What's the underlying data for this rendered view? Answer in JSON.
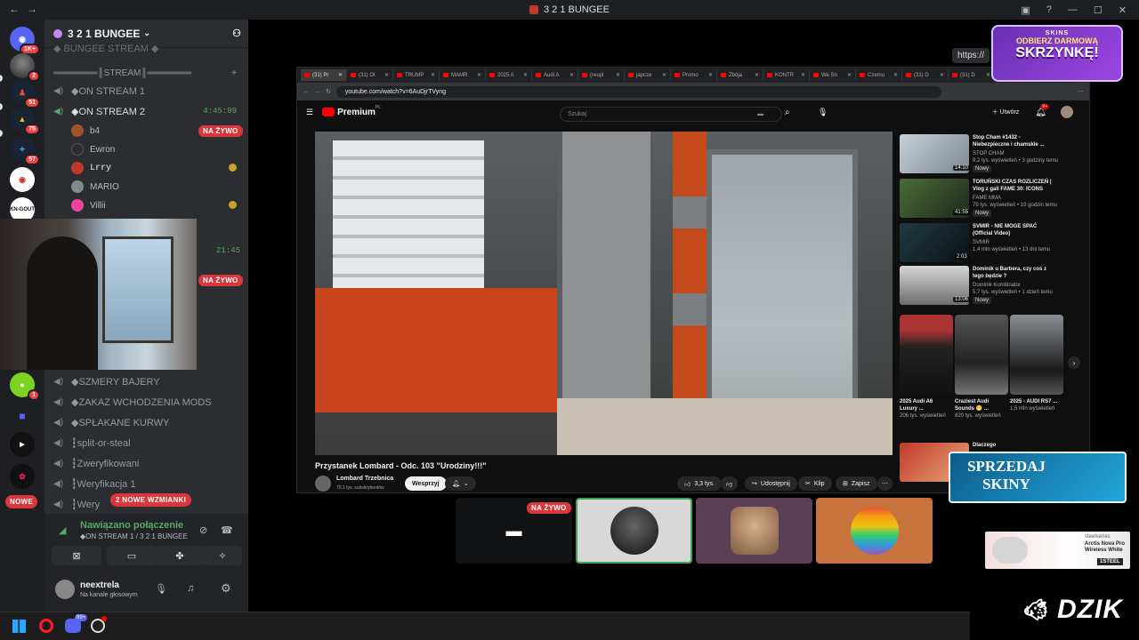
{
  "window": {
    "title": "3 2 1 BUNGEE"
  },
  "servers": [
    {
      "badge": "1K+"
    },
    {
      "badge": "2"
    },
    {
      "badge": "51"
    },
    {
      "badge": "75"
    },
    {
      "badge": "57"
    },
    {
      "badge": ""
    },
    {
      "label": "KN-GOUT",
      "badge": ""
    },
    {
      "badge": "1"
    }
  ],
  "server_header": {
    "name": "3 2 1 BUNGEE"
  },
  "channels": {
    "top_partial": "◆ BUNGEE STREAM ◆",
    "category": "═══════║STREAM║═══════",
    "on_stream_1": "◆ON STREAM 1",
    "on_stream_2": "◆ON STREAM 2",
    "on_stream_2_time": "4:45:09",
    "live_label": "NA ŻYWO",
    "hidden_time": "21:45",
    "szmery": "◆SZMERY BAJERY",
    "zakaz": "◆ZAKAZ WCHODZENIA MODS",
    "splakane": "◆SPŁAKANE KURWY",
    "split": "┇split-or-steal",
    "zweryfikowani": "┇Zweryfikowani",
    "weryfikacja": "┇Weryfikacja 1",
    "wery_partial": "┇Wery",
    "new_badge": "NOWE",
    "mentions": "2 NOWE WZMIANKI"
  },
  "users": [
    {
      "name": "b4"
    },
    {
      "name": "Ewron"
    },
    {
      "name": "Lrry"
    },
    {
      "name": "MARIO"
    },
    {
      "name": "Villii"
    }
  ],
  "voice": {
    "status": "Nawiązano połączenie",
    "channel": "◆ON STREAM 1 / 3 2 1 BUNGEE"
  },
  "account": {
    "name": "neextrela",
    "status": "Na kanale głosowym"
  },
  "browser": {
    "tabs": [
      "(31) Pr",
      "(31) Ol",
      "TRUMP",
      "MAMR",
      "2025 A",
      "Audi A",
      "(reupl",
      "japcze",
      "Promo",
      "Zbója",
      "KONTR",
      "We Sn",
      "Czemu",
      "(31) D",
      "(31) D"
    ],
    "url": "youtube.com/watch?v=6AuDjrTVyng"
  },
  "youtube": {
    "logo": "Premium",
    "logo_sup": "PL",
    "search_placeholder": "Szukaj",
    "create": "Utwórz",
    "notif_count": "9+",
    "video_title": "Przystanek Lombard - Odc. 103 \"Urodziny!!!\"",
    "channel": "Lombard Trzebnica",
    "subs": "70,1 tys. subskrybentów",
    "support": "Wesprzyj",
    "likes": "3,3 tys.",
    "share": "Udostępnij",
    "clip": "Klip",
    "save": "Zapisz",
    "recs": [
      {
        "title": "Stop Cham #1432 - Niebezpieczne i chamskie ...",
        "channel": "STOP CHAM",
        "meta": "9,2 tys. wyświetleń • 3 godziny temu",
        "tag": "Nowy",
        "duration": "14:10"
      },
      {
        "title": "TORUŃSKI CZAS ROZLICZEŃ | Vlog z gali FAME 30: ICONS",
        "channel": "FAME MMA",
        "meta": "79 tys. wyświetleń • 19 godzin temu",
        "tag": "Nowy",
        "duration": "41:55"
      },
      {
        "title": "SVMIR - NIE MOGE SPAĆ (Official Video)",
        "channel": "SVMIR",
        "meta": "1,4 mln wyświetleń • 13 dni temu",
        "tag": "",
        "duration": "2:03"
      },
      {
        "title": "Dominik u Barbera, czy coś z tego będzie ?",
        "channel": "Dominik Kombinator",
        "meta": "5,7 tys. wyświetleń • 1 dzień temu",
        "tag": "Nowy",
        "duration": "13:06"
      }
    ],
    "shorts": [
      {
        "title": "2025 Audi A6 Luxury ...",
        "views": "206 tys. wyświetleń"
      },
      {
        "title": "Craziest Audi Sounds 😬 ...",
        "views": "820 tys. wyświetleń"
      },
      {
        "title": "2025 - AUDI RS7 ...",
        "views": "1,5 mln wyświetleń"
      }
    ],
    "next_title": "Dlaczego"
  },
  "stream": {
    "live_label": "NA ŻYWO"
  },
  "ads": {
    "top_partial": "https://",
    "box_brand": "SKINS",
    "box_line1": "ODBIERZ DARMOWĄ",
    "box_line2": "SKRZYNKĘ!",
    "skin_line1": "SPRZEDAJ",
    "skin_line2": "SKINY",
    "steel_brand": "steelseries",
    "steel_product": "Arctis Nova Pro Wireless White",
    "steel_tag": "1STEEL",
    "dzik": "DZIK"
  },
  "taskbar": {
    "badge": "99+"
  },
  "colors": {
    "discord_red": "#da373c",
    "yt_red": "#ff0000",
    "accent_green": "#57a865",
    "discord_blurple": "#5865f2"
  }
}
